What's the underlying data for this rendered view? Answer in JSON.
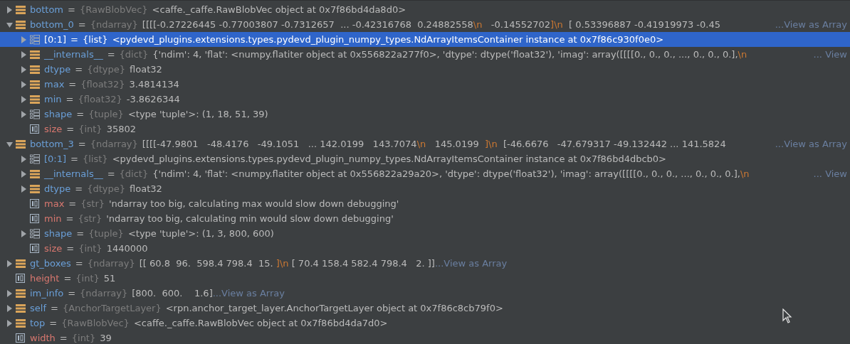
{
  "variables": [
    {
      "name": "bottom",
      "sep": "=",
      "type": "{RawBlobVec}",
      "kind": "array",
      "expanded": false,
      "selected": false,
      "value": [
        {
          "kind": "text",
          "text": "<caffe._caffe.RawBlobVec object at 0x7f86bd4da8d0>"
        }
      ]
    },
    {
      "name": "bottom_0",
      "sep": "=",
      "type": "{ndarray}",
      "kind": "array",
      "expanded": true,
      "selected": false,
      "truncated": true,
      "link": "...View as Array",
      "value": [
        {
          "kind": "text",
          "text": "[[[[-0.27226445 -0.77003807 -0.7312657  ... -0.42316768  0.24882558"
        },
        {
          "kind": "escape",
          "text": "\\n"
        },
        {
          "kind": "text",
          "text": "   -0.14552702"
        },
        {
          "kind": "escape",
          "text": "]\\n"
        },
        {
          "kind": "text",
          "text": "  [ 0.53396887 -0.41919973 -0.45"
        }
      ],
      "children": [
        {
          "name": "[0:1]",
          "sep": "=",
          "type": "{list}",
          "kind": "list",
          "expanded": false,
          "selected": true,
          "value": [
            {
              "kind": "text",
              "text": "<pydevd_plugins.extensions.types.pydevd_plugin_numpy_types.NdArrayItemsContainer instance at 0x7f86c930f0e0>"
            }
          ]
        },
        {
          "name": "__internals__",
          "sep": "=",
          "type": "{dict}",
          "kind": "array",
          "expanded": false,
          "selected": false,
          "truncated": true,
          "link": "... View",
          "value": [
            {
              "kind": "text",
              "text": "{'ndim': 4, 'flat': <numpy.flatiter object at 0x556822a277f0>, 'dtype': dtype('float32'), 'imag': array([[[[0., 0., 0., ..., 0., 0., 0.],"
            },
            {
              "kind": "escape",
              "text": "\\n"
            }
          ]
        },
        {
          "name": "dtype",
          "sep": "=",
          "type": "{dtype}",
          "kind": "array",
          "expanded": false,
          "selected": false,
          "value": [
            {
              "kind": "text",
              "text": "float32"
            }
          ]
        },
        {
          "name": "max",
          "sep": "=",
          "type": "{float32}",
          "kind": "array",
          "expanded": false,
          "selected": false,
          "value": [
            {
              "kind": "text",
              "text": "3.4814134"
            }
          ]
        },
        {
          "name": "min",
          "sep": "=",
          "type": "{float32}",
          "kind": "array",
          "expanded": false,
          "selected": false,
          "value": [
            {
              "kind": "text",
              "text": "-3.8626344"
            }
          ]
        },
        {
          "name": "shape",
          "sep": "=",
          "type": "{tuple}",
          "kind": "list",
          "expanded": false,
          "selected": false,
          "value": [
            {
              "kind": "text",
              "text": "<type 'tuple'>: (1, 18, 51, 39)"
            }
          ]
        },
        {
          "name": "size",
          "sep": "=",
          "type": "{int}",
          "kind": "primitive",
          "selected": false,
          "value": [
            {
              "kind": "text",
              "text": "35802"
            }
          ]
        }
      ]
    },
    {
      "name": "bottom_3",
      "sep": "=",
      "type": "{ndarray}",
      "kind": "array",
      "expanded": true,
      "selected": false,
      "truncated": true,
      "link": "...View as Array",
      "value": [
        {
          "kind": "text",
          "text": "[[[[-47.9801   -48.4176   -49.1051   ... 142.0199   143.7074"
        },
        {
          "kind": "escape",
          "text": "\\n"
        },
        {
          "kind": "text",
          "text": "   145.0199  "
        },
        {
          "kind": "escape",
          "text": "]\\n"
        },
        {
          "kind": "text",
          "text": "  [-46.6676   -47.679317 -49.132442 ... 141.5824"
        }
      ],
      "children": [
        {
          "name": "[0:1]",
          "sep": "=",
          "type": "{list}",
          "kind": "list",
          "expanded": false,
          "selected": false,
          "value": [
            {
              "kind": "text",
              "text": "<pydevd_plugins.extensions.types.pydevd_plugin_numpy_types.NdArrayItemsContainer instance at 0x7f86bd4dbcb0>"
            }
          ]
        },
        {
          "name": "__internals__",
          "sep": "=",
          "type": "{dict}",
          "kind": "array",
          "expanded": false,
          "selected": false,
          "truncated": true,
          "link": "... View",
          "value": [
            {
              "kind": "text",
              "text": "{'ndim': 4, 'flat': <numpy.flatiter object at 0x556822a29a20>, 'dtype': dtype('float32'), 'imag': array([[[[0., 0., 0., ..., 0., 0., 0.],"
            },
            {
              "kind": "escape",
              "text": "\\n"
            }
          ]
        },
        {
          "name": "dtype",
          "sep": "=",
          "type": "{dtype}",
          "kind": "array",
          "expanded": false,
          "selected": false,
          "value": [
            {
              "kind": "text",
              "text": "float32"
            }
          ]
        },
        {
          "name": "max",
          "sep": "=",
          "type": "{str}",
          "kind": "primitive",
          "selected": false,
          "value": [
            {
              "kind": "text",
              "text": "'ndarray too big, calculating max would slow down debugging'"
            }
          ]
        },
        {
          "name": "min",
          "sep": "=",
          "type": "{str}",
          "kind": "primitive",
          "selected": false,
          "value": [
            {
              "kind": "text",
              "text": "'ndarray too big, calculating min would slow down debugging'"
            }
          ]
        },
        {
          "name": "shape",
          "sep": "=",
          "type": "{tuple}",
          "kind": "list",
          "expanded": false,
          "selected": false,
          "value": [
            {
              "kind": "text",
              "text": "<type 'tuple'>: (1, 3, 800, 600)"
            }
          ]
        },
        {
          "name": "size",
          "sep": "=",
          "type": "{int}",
          "kind": "primitive",
          "selected": false,
          "value": [
            {
              "kind": "text",
              "text": "1440000"
            }
          ]
        }
      ]
    },
    {
      "name": "gt_boxes",
      "sep": "=",
      "type": "{ndarray}",
      "kind": "array",
      "expanded": false,
      "selected": false,
      "link": "...View as Array",
      "value": [
        {
          "kind": "text",
          "text": "[[ 60.8  96.  598.4 798.4  15. "
        },
        {
          "kind": "escape",
          "text": "]\\n"
        },
        {
          "kind": "text",
          "text": " [ 70.4 158.4 582.4 798.4   2. ]]"
        }
      ]
    },
    {
      "name": "height",
      "sep": "=",
      "type": "{int}",
      "kind": "primitive",
      "selected": false,
      "value": [
        {
          "kind": "text",
          "text": "51"
        }
      ]
    },
    {
      "name": "im_info",
      "sep": "=",
      "type": "{ndarray}",
      "kind": "array",
      "expanded": false,
      "selected": false,
      "link": "...View as Array",
      "value": [
        {
          "kind": "text",
          "text": "[800.  600.    1.6]"
        }
      ]
    },
    {
      "name": "self",
      "sep": "=",
      "type": "{AnchorTargetLayer}",
      "kind": "array",
      "expanded": false,
      "selected": false,
      "value": [
        {
          "kind": "text",
          "text": "<rpn.anchor_target_layer.AnchorTargetLayer object at 0x7f86c8cb79f0>"
        }
      ]
    },
    {
      "name": "top",
      "sep": "=",
      "type": "{RawBlobVec}",
      "kind": "array",
      "expanded": false,
      "selected": false,
      "value": [
        {
          "kind": "text",
          "text": "<caffe._caffe.RawBlobVec object at 0x7f86bd4da7d0>"
        }
      ]
    },
    {
      "name": "width",
      "sep": "=",
      "type": "{int}",
      "kind": "primitive",
      "selected": false,
      "value": [
        {
          "kind": "text",
          "text": "39"
        }
      ]
    }
  ]
}
